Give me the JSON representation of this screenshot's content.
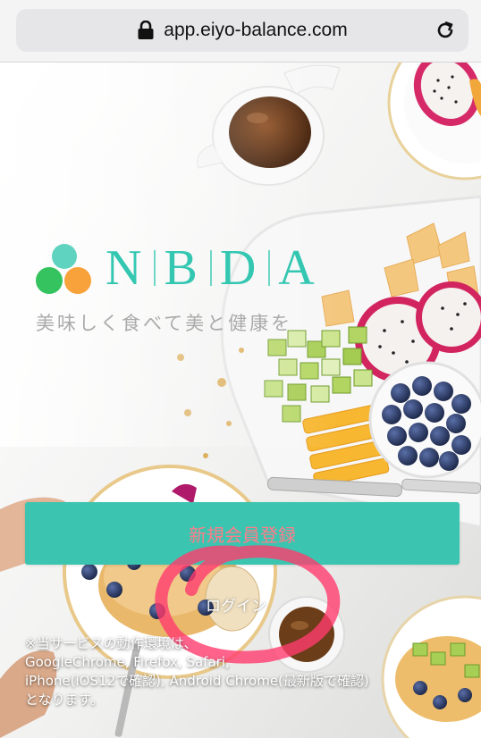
{
  "browser": {
    "url": "app.eiyo-balance.com",
    "lock_icon": "lock-icon",
    "reload_icon": "reload-icon"
  },
  "logo": {
    "letters": [
      "N",
      "B",
      "D",
      "A"
    ],
    "colors": {
      "teal": "#5fd3c0",
      "green": "#34c35e",
      "orange": "#f7a23a",
      "text": "#33c7b2"
    }
  },
  "tagline": "美味しく食べて美と健康を",
  "actions": {
    "signup_label": "新規会員登録",
    "login_label": "ログイン"
  },
  "notice": {
    "lines": [
      "※当サービスの動作環境は、",
      "GoogleChrome, Firefox, Safari,",
      "iPhone(iOS12で確認), Android Chrome(最新版で確認)",
      "となります。"
    ]
  },
  "colors": {
    "accent": "#3bc5b0",
    "annotation": "#ff3c6e"
  }
}
